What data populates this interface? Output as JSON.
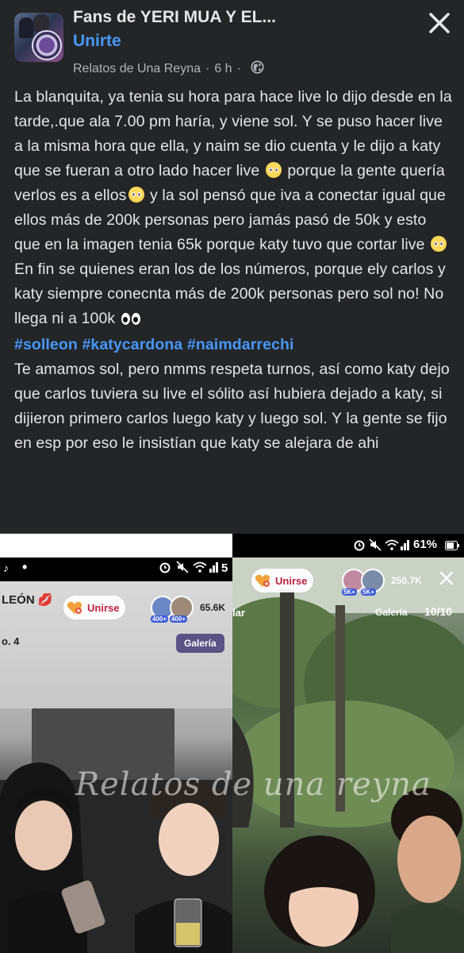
{
  "header": {
    "group_name": "Fans de YERI MUA Y EL...",
    "join_label": "Unirte",
    "author": "Relatos de Una Reyna",
    "separator": "·",
    "time": "6 h",
    "separator2": "·"
  },
  "post": {
    "paragraphs": [
      "La blanquita, ya tenia su hora para hace live lo dijo desde en la tarde,.que ala 7.00 pm haría, y viene sol. Y se puso hacer live a la misma hora que ella, y naim se dio cuenta y le dijo a katy que se fueran a otro lado hacer live",
      "porque la gente quería verlos es a ellos",
      "y la sol pensó que iva a conectar igual que ellos más de 200k personas pero jamás pasó de 50k y esto que en la imagen tenia 65k porque katy tuvo que cortar live",
      "En fin se quienes eran los de los números, porque ely carlos  y katy siempre conecnta más de 200k personas pero sol no! No llega ni a 100k"
    ],
    "hashtags": [
      "#solleon",
      "#katycardona",
      "#naimdarrechi"
    ],
    "closing": "Te amamos sol, pero nmms respeta turnos, así como katy dejo que carlos tuviera su live el sólito así hubiera dejado a katy, si dijieron primero carlos luego katy y luego sol. Y la gente se fijo en esp por eso le insistían que katy se alejara de ahi"
  },
  "left_shot": {
    "status_partial": "5",
    "name_partial": "LEÓN",
    "unirse_label": "Unirse",
    "badge1": "400+",
    "badge2": "400+",
    "viewers": "65.6K",
    "galeria_label": "Galería",
    "side_text": "o. 4"
  },
  "right_shot": {
    "battery": "61%",
    "unirse_label": "Unirse",
    "badge1": "5K+",
    "badge2": "5K+",
    "viewers": "250.7K",
    "side_text": "lar",
    "galeria_label": "Galería",
    "page_counter": "10/10"
  },
  "watermark": "Relatos de una reyna",
  "colors": {
    "background": "#242526",
    "text": "#e4e6eb",
    "link": "#4599ff",
    "meta": "#b0b3b8"
  },
  "icons": [
    "globe-icon",
    "close-icon",
    "pleading-face-emoji",
    "eyes-emoji",
    "heart-plus-icon",
    "alarm-icon",
    "mute-icon",
    "wifi-icon",
    "signal-icon"
  ]
}
